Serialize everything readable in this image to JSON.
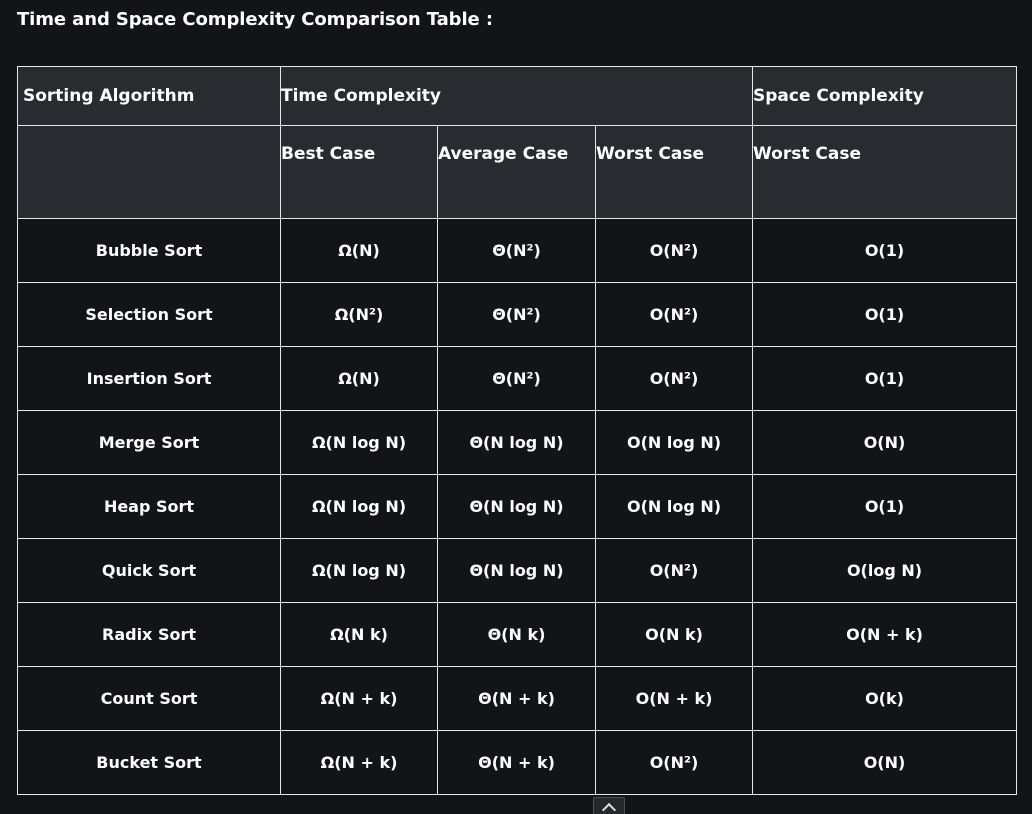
{
  "heading": "Time and Space Complexity Comparison Table :",
  "table": {
    "header_row1": [
      "Sorting Algorithm",
      "Time Complexity",
      "Space Complexity"
    ],
    "header_row2": [
      "",
      "Best Case",
      "Average Case",
      "Worst Case",
      "Worst Case"
    ],
    "rows": [
      [
        "Bubble Sort",
        "Ω(N)",
        "Θ(N²)",
        "O(N²)",
        "O(1)"
      ],
      [
        "Selection Sort",
        "Ω(N²)",
        "Θ(N²)",
        "O(N²)",
        "O(1)"
      ],
      [
        "Insertion Sort",
        "Ω(N)",
        "Θ(N²)",
        "O(N²)",
        "O(1)"
      ],
      [
        "Merge Sort",
        "Ω(N log N)",
        "Θ(N log N)",
        "O(N log N)",
        "O(N)"
      ],
      [
        "Heap Sort",
        "Ω(N log N)",
        "Θ(N log N)",
        "O(N log N)",
        "O(1)"
      ],
      [
        "Quick Sort",
        "Ω(N log N)",
        "Θ(N log N)",
        "O(N²)",
        "O(log N)"
      ],
      [
        "Radix Sort",
        "Ω(N k)",
        "Θ(N k)",
        "O(N k)",
        "O(N + k)"
      ],
      [
        "Count Sort",
        "Ω(N + k)",
        "Θ(N + k)",
        "O(N + k)",
        "O(k)"
      ],
      [
        "Bucket Sort",
        "Ω(N + k)",
        "Θ(N + k)",
        "O(N²)",
        "O(N)"
      ]
    ]
  },
  "controls": {
    "scroll_top_icon": "chevron-up-icon"
  },
  "colors": {
    "background": "#131417",
    "header_background": "#282b2f",
    "border": "#e6e6e6",
    "text": "#ffffff"
  }
}
